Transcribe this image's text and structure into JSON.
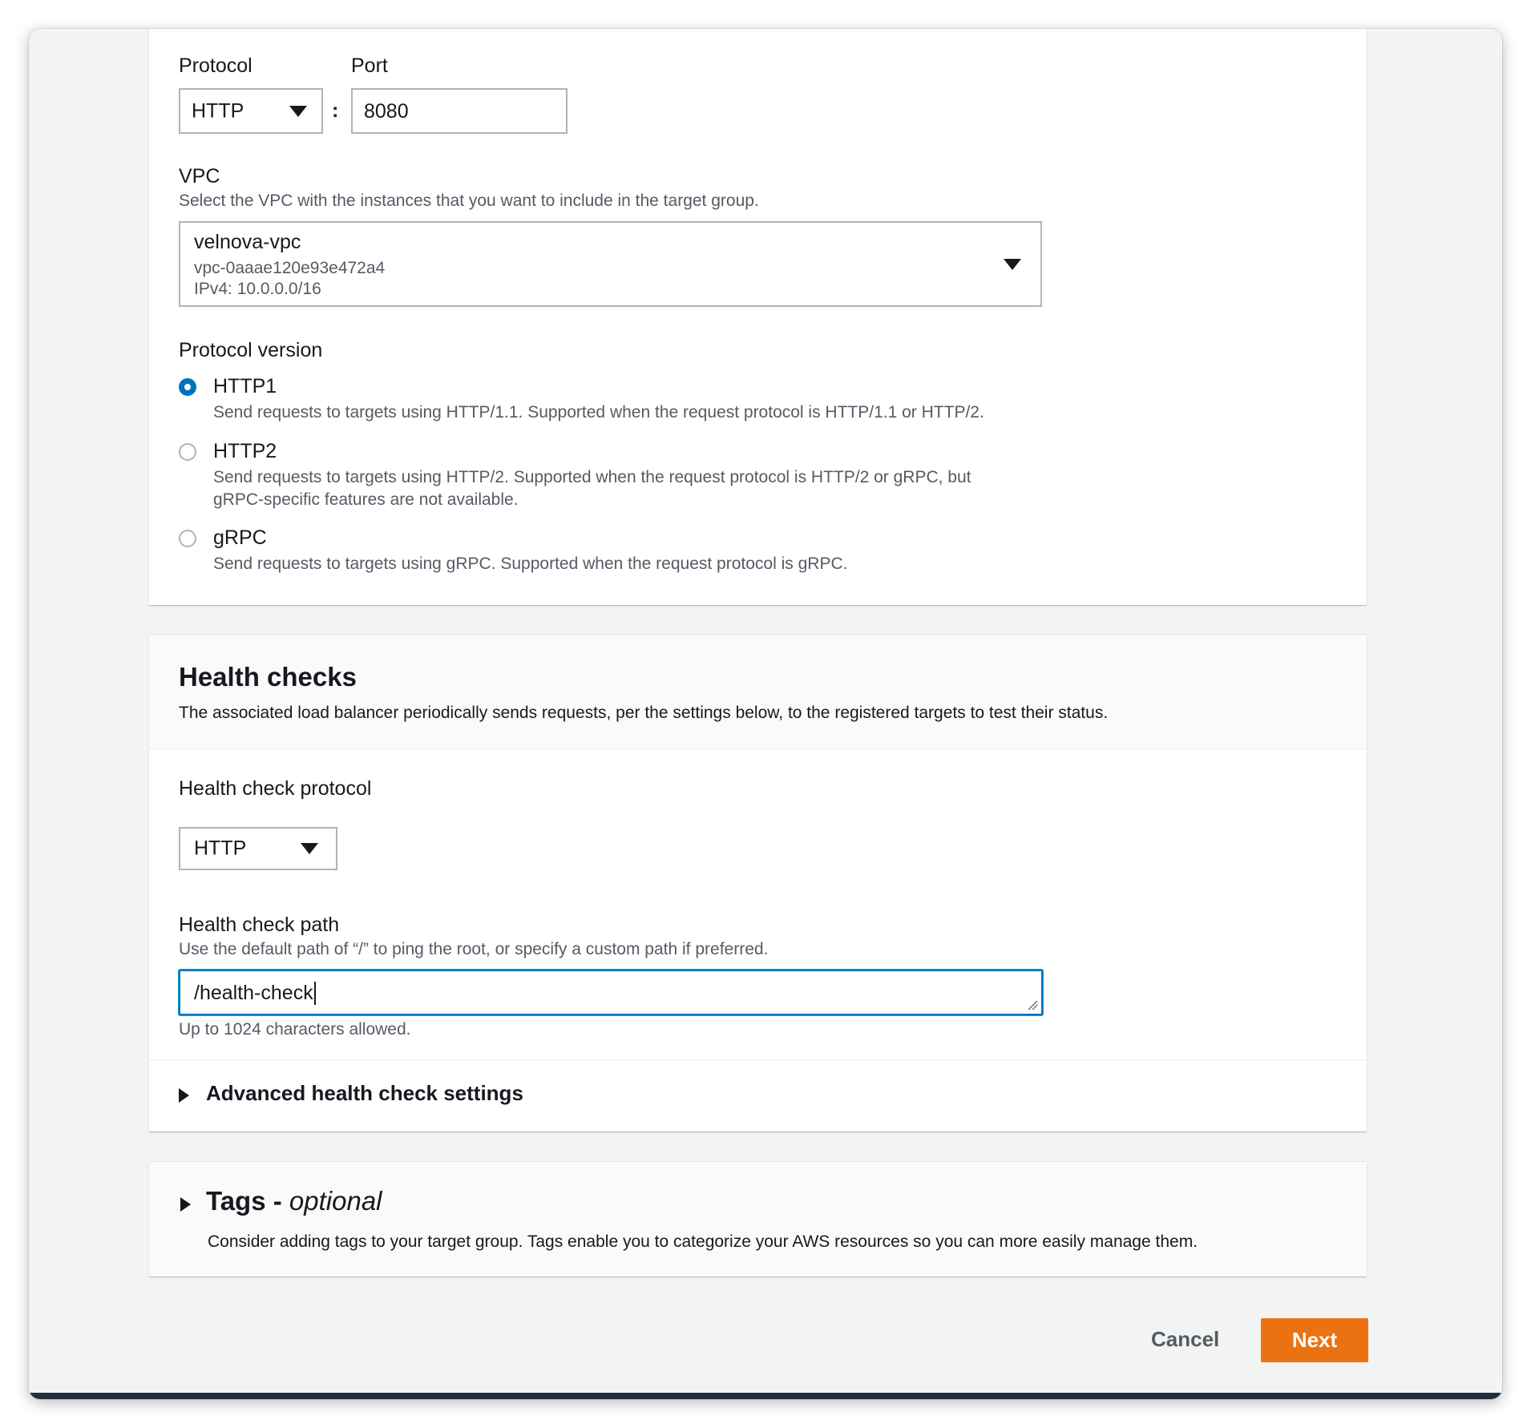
{
  "target": {
    "protocol_label": "Protocol",
    "protocol_value": "HTTP",
    "port_label": "Port",
    "port_separator": ":",
    "port_value": "8080",
    "vpc_label": "VPC",
    "vpc_desc": "Select the VPC with the instances that you want to include in the target group.",
    "vpc_name": "velnova-vpc",
    "vpc_id": "vpc-0aaae120e93e472a4",
    "vpc_cidr": "IPv4: 10.0.0.0/16",
    "protocol_version_label": "Protocol version",
    "versions": [
      {
        "label": "HTTP1",
        "desc": "Send requests to targets using HTTP/1.1. Supported when the request protocol is HTTP/1.1 or HTTP/2.",
        "desc2": "",
        "checked": true
      },
      {
        "label": "HTTP2",
        "desc": "Send requests to targets using HTTP/2. Supported when the request protocol is HTTP/2 or gRPC, but",
        "desc2": "gRPC-specific features are not available.",
        "checked": false
      },
      {
        "label": "gRPC",
        "desc": "Send requests to targets using gRPC. Supported when the request protocol is gRPC.",
        "desc2": "",
        "checked": false
      }
    ]
  },
  "health": {
    "title": "Health checks",
    "desc": "The associated load balancer periodically sends requests, per the settings below, to the registered targets to test their status.",
    "protocol_label": "Health check protocol",
    "protocol_value": "HTTP",
    "path_label": "Health check path",
    "path_desc": "Use the default path of “/” to ping the root, or specify a custom path if preferred.",
    "path_value": "/health-check",
    "path_constraint": "Up to 1024 characters allowed.",
    "advanced_label": "Advanced health check settings"
  },
  "tags": {
    "title": "Tags",
    "separator": " - ",
    "optional": "optional",
    "desc": "Consider adding tags to your target group. Tags enable you to categorize your AWS resources so you can more easily manage them."
  },
  "footer": {
    "cancel_label": "Cancel",
    "next_label": "Next"
  },
  "colors": {
    "primary_button": "#ec7211",
    "focus_border": "#0073bb",
    "radio_checked": "#0073bb"
  }
}
